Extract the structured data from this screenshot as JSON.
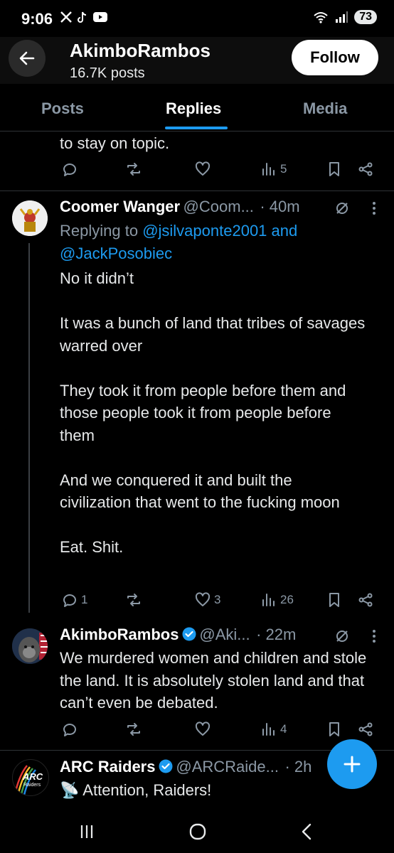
{
  "status_bar": {
    "time": "9:06",
    "battery": "73"
  },
  "header": {
    "title": "AkimboRambos",
    "subtitle": "16.7K posts",
    "follow_label": "Follow"
  },
  "tabs": [
    {
      "label": "Posts"
    },
    {
      "label": "Replies"
    },
    {
      "label": "Media"
    }
  ],
  "top_post": {
    "text": "to stay on topic.",
    "views": "5"
  },
  "reply1": {
    "name": "Coomer Wanger",
    "handle": "@Coom...",
    "time": "· 40m",
    "replying_prefix": "Replying to ",
    "replying_user1": "@jsilvaponte2001",
    "replying_and": " and",
    "replying_user2": "@JackPosobiec",
    "text": "No it didn’t\n\nIt was a bunch of land that tribes of savages warred over\n\nThey took it from people before them and those people took it from people before them\n\nAnd we conquered it and built the civilization that went to the fucking moon\n\nEat. Shit.",
    "replies": "1",
    "likes": "3",
    "views": "26"
  },
  "reply2": {
    "name": "AkimboRambos",
    "handle": "@Aki...",
    "time": "· 22m",
    "text": "We murdered women and children and stole the land. It is absolutely stolen land and that can’t even be debated.",
    "views": "4"
  },
  "reply3": {
    "name": "ARC Raiders",
    "handle": "@ARCRaide...",
    "time": "· 2h",
    "text": "📡 Attention, Raiders!",
    "avatar_text": "ARC Raiders"
  },
  "colors": {
    "accent": "#1d9bf0",
    "background": "#000000",
    "muted": "#8b98a5"
  }
}
